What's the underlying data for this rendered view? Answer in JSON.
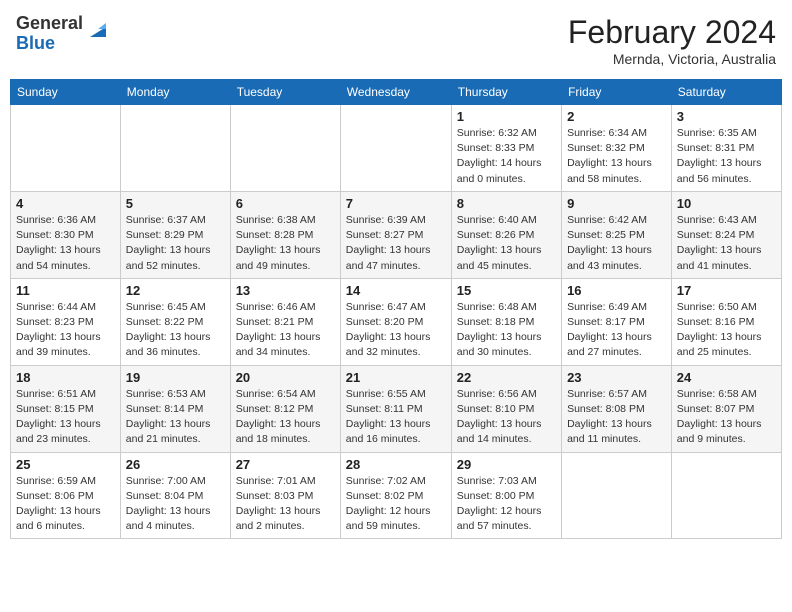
{
  "header": {
    "logo_line1": "General",
    "logo_line2": "Blue",
    "month_title": "February 2024",
    "subtitle": "Mernda, Victoria, Australia"
  },
  "days_of_week": [
    "Sunday",
    "Monday",
    "Tuesday",
    "Wednesday",
    "Thursday",
    "Friday",
    "Saturday"
  ],
  "weeks": [
    [
      {
        "num": "",
        "info": ""
      },
      {
        "num": "",
        "info": ""
      },
      {
        "num": "",
        "info": ""
      },
      {
        "num": "",
        "info": ""
      },
      {
        "num": "1",
        "info": "Sunrise: 6:32 AM\nSunset: 8:33 PM\nDaylight: 14 hours\nand 0 minutes."
      },
      {
        "num": "2",
        "info": "Sunrise: 6:34 AM\nSunset: 8:32 PM\nDaylight: 13 hours\nand 58 minutes."
      },
      {
        "num": "3",
        "info": "Sunrise: 6:35 AM\nSunset: 8:31 PM\nDaylight: 13 hours\nand 56 minutes."
      }
    ],
    [
      {
        "num": "4",
        "info": "Sunrise: 6:36 AM\nSunset: 8:30 PM\nDaylight: 13 hours\nand 54 minutes."
      },
      {
        "num": "5",
        "info": "Sunrise: 6:37 AM\nSunset: 8:29 PM\nDaylight: 13 hours\nand 52 minutes."
      },
      {
        "num": "6",
        "info": "Sunrise: 6:38 AM\nSunset: 8:28 PM\nDaylight: 13 hours\nand 49 minutes."
      },
      {
        "num": "7",
        "info": "Sunrise: 6:39 AM\nSunset: 8:27 PM\nDaylight: 13 hours\nand 47 minutes."
      },
      {
        "num": "8",
        "info": "Sunrise: 6:40 AM\nSunset: 8:26 PM\nDaylight: 13 hours\nand 45 minutes."
      },
      {
        "num": "9",
        "info": "Sunrise: 6:42 AM\nSunset: 8:25 PM\nDaylight: 13 hours\nand 43 minutes."
      },
      {
        "num": "10",
        "info": "Sunrise: 6:43 AM\nSunset: 8:24 PM\nDaylight: 13 hours\nand 41 minutes."
      }
    ],
    [
      {
        "num": "11",
        "info": "Sunrise: 6:44 AM\nSunset: 8:23 PM\nDaylight: 13 hours\nand 39 minutes."
      },
      {
        "num": "12",
        "info": "Sunrise: 6:45 AM\nSunset: 8:22 PM\nDaylight: 13 hours\nand 36 minutes."
      },
      {
        "num": "13",
        "info": "Sunrise: 6:46 AM\nSunset: 8:21 PM\nDaylight: 13 hours\nand 34 minutes."
      },
      {
        "num": "14",
        "info": "Sunrise: 6:47 AM\nSunset: 8:20 PM\nDaylight: 13 hours\nand 32 minutes."
      },
      {
        "num": "15",
        "info": "Sunrise: 6:48 AM\nSunset: 8:18 PM\nDaylight: 13 hours\nand 30 minutes."
      },
      {
        "num": "16",
        "info": "Sunrise: 6:49 AM\nSunset: 8:17 PM\nDaylight: 13 hours\nand 27 minutes."
      },
      {
        "num": "17",
        "info": "Sunrise: 6:50 AM\nSunset: 8:16 PM\nDaylight: 13 hours\nand 25 minutes."
      }
    ],
    [
      {
        "num": "18",
        "info": "Sunrise: 6:51 AM\nSunset: 8:15 PM\nDaylight: 13 hours\nand 23 minutes."
      },
      {
        "num": "19",
        "info": "Sunrise: 6:53 AM\nSunset: 8:14 PM\nDaylight: 13 hours\nand 21 minutes."
      },
      {
        "num": "20",
        "info": "Sunrise: 6:54 AM\nSunset: 8:12 PM\nDaylight: 13 hours\nand 18 minutes."
      },
      {
        "num": "21",
        "info": "Sunrise: 6:55 AM\nSunset: 8:11 PM\nDaylight: 13 hours\nand 16 minutes."
      },
      {
        "num": "22",
        "info": "Sunrise: 6:56 AM\nSunset: 8:10 PM\nDaylight: 13 hours\nand 14 minutes."
      },
      {
        "num": "23",
        "info": "Sunrise: 6:57 AM\nSunset: 8:08 PM\nDaylight: 13 hours\nand 11 minutes."
      },
      {
        "num": "24",
        "info": "Sunrise: 6:58 AM\nSunset: 8:07 PM\nDaylight: 13 hours\nand 9 minutes."
      }
    ],
    [
      {
        "num": "25",
        "info": "Sunrise: 6:59 AM\nSunset: 8:06 PM\nDaylight: 13 hours\nand 6 minutes."
      },
      {
        "num": "26",
        "info": "Sunrise: 7:00 AM\nSunset: 8:04 PM\nDaylight: 13 hours\nand 4 minutes."
      },
      {
        "num": "27",
        "info": "Sunrise: 7:01 AM\nSunset: 8:03 PM\nDaylight: 13 hours\nand 2 minutes."
      },
      {
        "num": "28",
        "info": "Sunrise: 7:02 AM\nSunset: 8:02 PM\nDaylight: 12 hours\nand 59 minutes."
      },
      {
        "num": "29",
        "info": "Sunrise: 7:03 AM\nSunset: 8:00 PM\nDaylight: 12 hours\nand 57 minutes."
      },
      {
        "num": "",
        "info": ""
      },
      {
        "num": "",
        "info": ""
      }
    ]
  ]
}
